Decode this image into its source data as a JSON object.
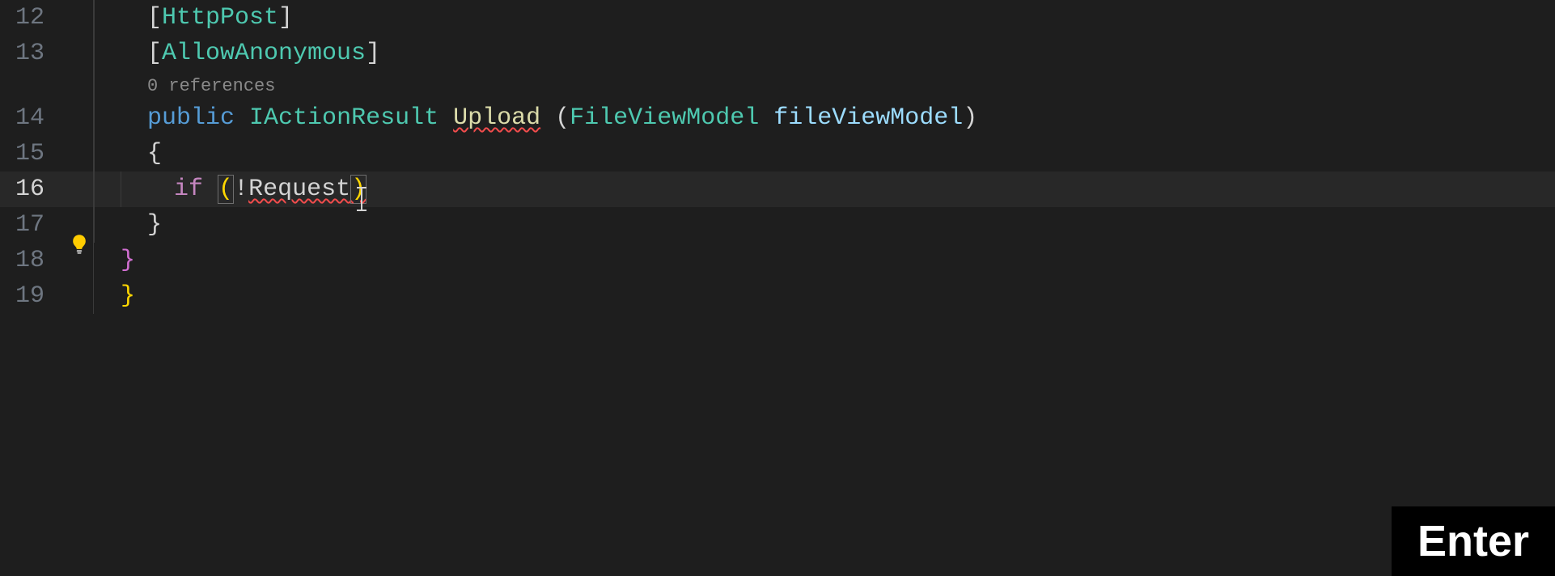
{
  "lines": {
    "l12": {
      "num": "12",
      "attr": "HttpPost"
    },
    "l13": {
      "num": "13",
      "attr": "AllowAnonymous"
    },
    "lcl": {
      "text": "0 references"
    },
    "l14": {
      "num": "14",
      "kw": "public",
      "type": "IActionResult",
      "method": "Upload",
      "ptype": "FileViewModel",
      "pname": "fileViewModel"
    },
    "l15": {
      "num": "15",
      "brace": "{"
    },
    "l16": {
      "num": "16",
      "kw": "if",
      "po": "(",
      "neg": "!",
      "ident": "Request",
      "pc": ")"
    },
    "l17": {
      "num": "17",
      "brace": "}"
    },
    "l18": {
      "num": "18",
      "brace": "}"
    },
    "l19": {
      "num": "19",
      "brace": "}"
    }
  },
  "overlay": {
    "enter": "Enter"
  }
}
